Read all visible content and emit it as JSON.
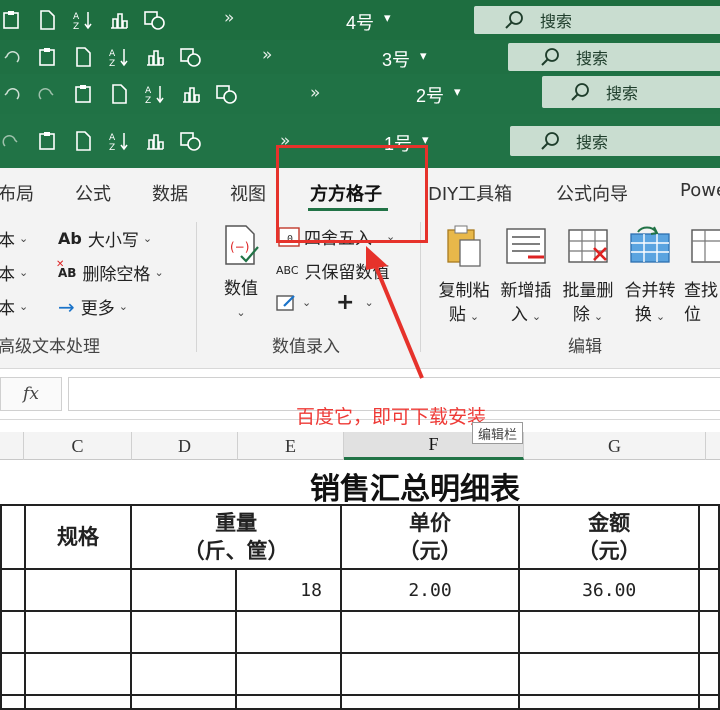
{
  "windows": [
    {
      "title": "4号",
      "search_label": "搜索"
    },
    {
      "title": "3号",
      "search_label": "搜索"
    },
    {
      "title": "2号",
      "search_label": "搜索"
    },
    {
      "title": "1号",
      "search_label": "搜索"
    }
  ],
  "overflow_glyph": "»",
  "dropdown_glyph": "▾",
  "ribbon": {
    "tabs": [
      "布局",
      "公式",
      "数据",
      "视图",
      "方方格子",
      "DIY工具箱",
      "公式向导",
      "Powe"
    ],
    "active_tab": "方方格子",
    "text_group": {
      "partial_items": [
        "本",
        "本",
        "本"
      ],
      "case_label": "大小写",
      "case_icon_text": "Ab",
      "delete_space_label": "删除空格",
      "delete_space_icon_text": "AB",
      "more_label": "更多",
      "group_label": "高级文本处理"
    },
    "number_group": {
      "value_label": "数值",
      "round_label": "四舍五入",
      "keep_label": "只保留数值",
      "keep_icon_text": "ABC",
      "plus_label": "+",
      "group_label": "数值录入"
    },
    "edit_group": {
      "buttons": [
        {
          "line1": "复制粘",
          "line2": "贴"
        },
        {
          "line1": "新增插",
          "line2": "入"
        },
        {
          "line1": "批量删",
          "line2": "除"
        },
        {
          "line1": "合并转",
          "line2": "换"
        },
        {
          "line1": "查找",
          "line2": "位"
        }
      ],
      "group_label": "编辑"
    }
  },
  "formula_bar": {
    "fx_label": "fx",
    "value": ""
  },
  "columns": [
    "C",
    "D",
    "E",
    "F",
    "G"
  ],
  "selected_column": "F",
  "sheet": {
    "title": "销售汇总明细表",
    "headers": {
      "spec": "规格",
      "weight_line1": "重量",
      "weight_line2": "（斤、筐）",
      "price_line1": "单价",
      "price_line2": "（元）",
      "amount_line1": "金额",
      "amount_line2": "（元）"
    },
    "row1": {
      "weight": "18",
      "price": "2.00",
      "amount": "36.00"
    }
  },
  "annotation": {
    "text": "百度它，即可下载安装",
    "tooltip": "编辑栏",
    "highlight_color": "#e6322b"
  },
  "colors": {
    "excel_green": "#217346",
    "annotation_red": "#ee3a36"
  }
}
